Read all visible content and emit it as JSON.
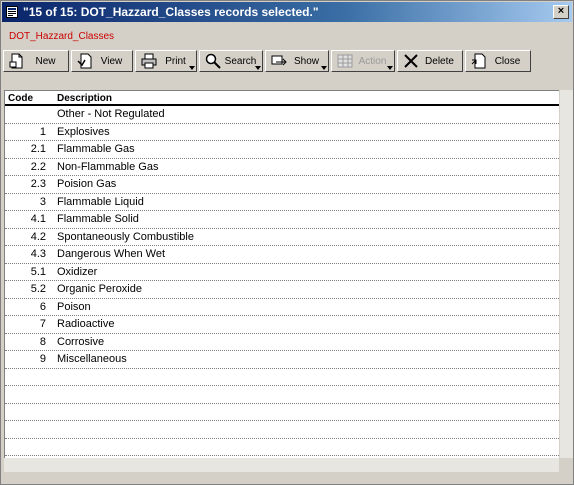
{
  "window": {
    "title": "\"15 of 15: DOT_Hazzard_Classes records selected.\"",
    "close_glyph": "×"
  },
  "subtitle": "DOT_Hazzard_Classes",
  "toolbar": [
    {
      "key": "new",
      "label": "New",
      "icon": "new-document-icon",
      "disabled": false,
      "dropdown": false
    },
    {
      "key": "view",
      "label": "View",
      "icon": "view-document-icon",
      "disabled": false,
      "dropdown": false
    },
    {
      "key": "print",
      "label": "Print",
      "icon": "printer-icon",
      "disabled": false,
      "dropdown": true
    },
    {
      "key": "search",
      "label": "Search",
      "icon": "magnifier-icon",
      "disabled": false,
      "dropdown": true
    },
    {
      "key": "show",
      "label": "Show",
      "icon": "show-records-icon",
      "disabled": false,
      "dropdown": true
    },
    {
      "key": "action",
      "label": "Action",
      "icon": "action-grid-icon",
      "disabled": true,
      "dropdown": true
    },
    {
      "key": "delete",
      "label": "Delete",
      "icon": "delete-x-icon",
      "disabled": false,
      "dropdown": false
    },
    {
      "key": "close",
      "label": "Close",
      "icon": "close-document-icon",
      "disabled": false,
      "dropdown": false
    }
  ],
  "table": {
    "columns": {
      "code": "Code",
      "description": "Description"
    },
    "rows": [
      {
        "code": "",
        "description": "Other - Not Regulated"
      },
      {
        "code": "1",
        "description": "Explosives"
      },
      {
        "code": "2.1",
        "description": "Flammable Gas"
      },
      {
        "code": "2.2",
        "description": "Non-Flammable Gas"
      },
      {
        "code": "2.3",
        "description": "Poision Gas"
      },
      {
        "code": "3",
        "description": "Flammable Liquid"
      },
      {
        "code": "4.1",
        "description": "Flammable Solid"
      },
      {
        "code": "4.2",
        "description": "Spontaneously Combustible"
      },
      {
        "code": "4.3",
        "description": "Dangerous When Wet"
      },
      {
        "code": "5.1",
        "description": "Oxidizer"
      },
      {
        "code": "5.2",
        "description": "Organic Peroxide"
      },
      {
        "code": "6",
        "description": "Poison"
      },
      {
        "code": "7",
        "description": "Radioactive"
      },
      {
        "code": "8",
        "description": "Corrosive"
      },
      {
        "code": "9",
        "description": "Miscellaneous"
      },
      {
        "code": "",
        "description": ""
      },
      {
        "code": "",
        "description": ""
      },
      {
        "code": "",
        "description": ""
      },
      {
        "code": "",
        "description": ""
      },
      {
        "code": "",
        "description": ""
      }
    ]
  },
  "colors": {
    "subtitle": "#cc0000",
    "titlebar_start": "#0a246a",
    "titlebar_end": "#a6caf0",
    "face": "#d4d0c8"
  }
}
